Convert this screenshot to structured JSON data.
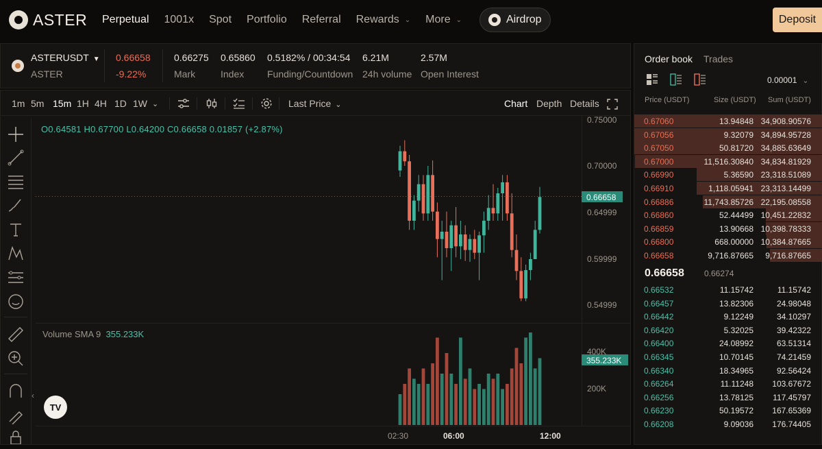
{
  "nav": {
    "brand": "ASTER",
    "items": [
      {
        "label": "Perpetual",
        "active": true
      },
      {
        "label": "1001x",
        "active": false
      },
      {
        "label": "Spot",
        "active": false
      },
      {
        "label": "Portfolio",
        "active": false
      },
      {
        "label": "Referral",
        "active": false
      },
      {
        "label": "Rewards",
        "active": false,
        "dropdown": true
      },
      {
        "label": "More",
        "active": false,
        "dropdown": true
      }
    ],
    "airdrop": "Airdrop",
    "deposit": "Deposit"
  },
  "ticker": {
    "symbol": "ASTERUSDT",
    "base": "ASTER",
    "last_price": "0.66658",
    "change": "-9.22%",
    "mark": "0.66275",
    "mark_label": "Mark",
    "index": "0.65860",
    "index_label": "Index",
    "funding": "0.5182% / 00:34:54",
    "funding_label": "Funding/Countdown",
    "volume": "6.21M",
    "volume_label": "24h volume",
    "oi": "2.57M",
    "oi_label": "Open Interest"
  },
  "toolbar": {
    "intervals": [
      "1m",
      "5m",
      "15m",
      "1H",
      "4H",
      "1D",
      "1W"
    ],
    "active_interval": "15m",
    "price_type": "Last Price",
    "views": [
      "Chart",
      "Depth",
      "Details"
    ],
    "active_view": "Chart"
  },
  "ohlc": {
    "open": "O0.64581",
    "high": "H0.67700",
    "low": "L0.64200",
    "close": "C0.66658",
    "change": "0.01857 (+2.87%)"
  },
  "price_axis": [
    "0.75000",
    "0.70000",
    "0.64999",
    "0.59999",
    "0.54999"
  ],
  "current_price_tag": "0.66658",
  "volume": {
    "label": "Volume SMA 9",
    "value": "355.233K",
    "axis": [
      "400K",
      "200K"
    ],
    "tag": "355.233K"
  },
  "time_axis": [
    "02:30",
    "06:00",
    "12:00"
  ],
  "candles": [
    {
      "o": 0.695,
      "h": 0.722,
      "l": 0.688,
      "c": 0.716
    },
    {
      "o": 0.716,
      "h": 0.728,
      "l": 0.7,
      "c": 0.705
    },
    {
      "o": 0.705,
      "h": 0.712,
      "l": 0.63,
      "c": 0.64
    },
    {
      "o": 0.64,
      "h": 0.668,
      "l": 0.63,
      "c": 0.662
    },
    {
      "o": 0.662,
      "h": 0.69,
      "l": 0.65,
      "c": 0.68
    },
    {
      "o": 0.68,
      "h": 0.69,
      "l": 0.64,
      "c": 0.648
    },
    {
      "o": 0.648,
      "h": 0.7,
      "l": 0.64,
      "c": 0.69
    },
    {
      "o": 0.69,
      "h": 0.706,
      "l": 0.64,
      "c": 0.65
    },
    {
      "o": 0.65,
      "h": 0.66,
      "l": 0.6,
      "c": 0.62
    },
    {
      "o": 0.62,
      "h": 0.64,
      "l": 0.575,
      "c": 0.628
    },
    {
      "o": 0.628,
      "h": 0.65,
      "l": 0.6,
      "c": 0.61
    },
    {
      "o": 0.61,
      "h": 0.64,
      "l": 0.585,
      "c": 0.635
    },
    {
      "o": 0.635,
      "h": 0.655,
      "l": 0.6,
      "c": 0.612
    },
    {
      "o": 0.612,
      "h": 0.64,
      "l": 0.598,
      "c": 0.625
    },
    {
      "o": 0.625,
      "h": 0.635,
      "l": 0.596,
      "c": 0.608
    },
    {
      "o": 0.608,
      "h": 0.625,
      "l": 0.595,
      "c": 0.62
    },
    {
      "o": 0.62,
      "h": 0.63,
      "l": 0.598,
      "c": 0.605
    },
    {
      "o": 0.605,
      "h": 0.628,
      "l": 0.575,
      "c": 0.624
    },
    {
      "o": 0.624,
      "h": 0.65,
      "l": 0.605,
      "c": 0.64
    },
    {
      "o": 0.64,
      "h": 0.668,
      "l": 0.63,
      "c": 0.654
    },
    {
      "o": 0.654,
      "h": 0.68,
      "l": 0.64,
      "c": 0.648
    },
    {
      "o": 0.648,
      "h": 0.676,
      "l": 0.64,
      "c": 0.67
    },
    {
      "o": 0.67,
      "h": 0.69,
      "l": 0.64,
      "c": 0.682
    },
    {
      "o": 0.682,
      "h": 0.69,
      "l": 0.64,
      "c": 0.648
    },
    {
      "o": 0.648,
      "h": 0.67,
      "l": 0.6,
      "c": 0.608
    },
    {
      "o": 0.608,
      "h": 0.625,
      "l": 0.575,
      "c": 0.585
    },
    {
      "o": 0.585,
      "h": 0.6,
      "l": 0.552,
      "c": 0.555
    },
    {
      "o": 0.555,
      "h": 0.592,
      "l": 0.552,
      "c": 0.586
    },
    {
      "o": 0.586,
      "h": 0.605,
      "l": 0.575,
      "c": 0.598
    },
    {
      "o": 0.598,
      "h": 0.64,
      "l": 0.598,
      "c": 0.63
    },
    {
      "o": 0.63,
      "h": 0.677,
      "l": 0.626,
      "c": 0.666
    }
  ],
  "volumes": [
    0.3,
    0.4,
    0.55,
    0.45,
    0.4,
    0.55,
    0.4,
    0.6,
    0.85,
    0.5,
    0.7,
    0.5,
    0.4,
    0.85,
    0.45,
    0.55,
    0.35,
    0.4,
    0.35,
    0.5,
    0.45,
    0.5,
    0.35,
    0.4,
    0.55,
    0.75,
    0.6,
    0.85,
    0.9,
    0.55,
    0.65
  ],
  "orderbook": {
    "tabs": [
      "Order book",
      "Trades"
    ],
    "active_tab": "Order book",
    "precision": "0.00001",
    "headers": [
      "Price (USDT)",
      "Size (USDT)",
      "Sum (USDT)"
    ],
    "asks": [
      {
        "price": "0.67060",
        "size": "13.94848",
        "sum": "34,908.90576",
        "depth": 1.0
      },
      {
        "price": "0.67056",
        "size": "9.32079",
        "sum": "34,894.95728",
        "depth": 0.999
      },
      {
        "price": "0.67050",
        "size": "50.81720",
        "sum": "34,885.63649",
        "depth": 0.999
      },
      {
        "price": "0.67000",
        "size": "11,516.30840",
        "sum": "34,834.81929",
        "depth": 0.997
      },
      {
        "price": "0.66990",
        "size": "5.36590",
        "sum": "23,318.51089",
        "depth": 0.668
      },
      {
        "price": "0.66910",
        "size": "1,118.05941",
        "sum": "23,313.14499",
        "depth": 0.668
      },
      {
        "price": "0.66886",
        "size": "11,743.85726",
        "sum": "22,195.08558",
        "depth": 0.636
      },
      {
        "price": "0.66860",
        "size": "52.44499",
        "sum": "10,451.22832",
        "depth": 0.299
      },
      {
        "price": "0.66859",
        "size": "13.90668",
        "sum": "10,398.78333",
        "depth": 0.298
      },
      {
        "price": "0.66800",
        "size": "668.00000",
        "sum": "10,384.87665",
        "depth": 0.297
      },
      {
        "price": "0.66658",
        "size": "9,716.87665",
        "sum": "9,716.87665",
        "depth": 0.278
      }
    ],
    "mid_price": "0.66658",
    "mark_price": "0.66274",
    "bids": [
      {
        "price": "0.66532",
        "size": "11.15742",
        "sum": "11.15742"
      },
      {
        "price": "0.66457",
        "size": "13.82306",
        "sum": "24.98048"
      },
      {
        "price": "0.66442",
        "size": "9.12249",
        "sum": "34.10297"
      },
      {
        "price": "0.66420",
        "size": "5.32025",
        "sum": "39.42322"
      },
      {
        "price": "0.66400",
        "size": "24.08992",
        "sum": "63.51314"
      },
      {
        "price": "0.66345",
        "size": "10.70145",
        "sum": "74.21459"
      },
      {
        "price": "0.66340",
        "size": "18.34965",
        "sum": "92.56424"
      },
      {
        "price": "0.66264",
        "size": "11.11248",
        "sum": "103.67672"
      },
      {
        "price": "0.66256",
        "size": "13.78125",
        "sum": "117.45797"
      },
      {
        "price": "0.66230",
        "size": "50.19572",
        "sum": "167.65369"
      },
      {
        "price": "0.66208",
        "size": "9.09036",
        "sum": "176.74405"
      }
    ]
  },
  "colors": {
    "up": "#3fb59c",
    "down": "#e8705a",
    "accent": "#f0c89a"
  }
}
